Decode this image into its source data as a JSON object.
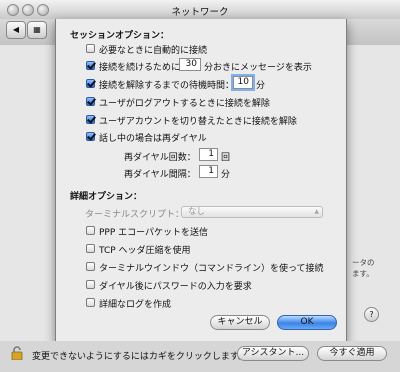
{
  "window": {
    "title": "ネットワーク"
  },
  "sheet": {
    "session_heading": "セッションオプション：",
    "session_options": [
      {
        "label": "必要なときに自動的に接続",
        "checked": false
      },
      {
        "label_before": "接続を続けるために",
        "value": "30",
        "label_after": "分おきにメッセージを表示",
        "checked": true
      },
      {
        "label_before": "接続を解除するまでの待機時間：",
        "value": "10",
        "label_after": "分",
        "checked": true
      },
      {
        "label": "ユーザがログアウトするときに接続を解除",
        "checked": true
      },
      {
        "label": "ユーザアカウントを切り替えたときに接続を解除",
        "checked": true
      },
      {
        "label": "話し中の場合は再ダイヤル",
        "checked": true
      }
    ],
    "redial_count": {
      "label": "再ダイヤル回数：",
      "value": "1",
      "unit": "回"
    },
    "redial_interval": {
      "label": "再ダイヤル間隔：",
      "value": "1",
      "unit": "分"
    },
    "advanced_heading": "詳細オプション：",
    "terminal_script": {
      "label": "ターミナルスクリプト：",
      "value": "なし"
    },
    "advanced_options": [
      {
        "label": "PPP エコーパケットを送信",
        "checked": false
      },
      {
        "label": "TCP ヘッダ圧縮を使用",
        "checked": false
      },
      {
        "label": "ターミナルウインドウ（コマンドライン）を使って接続",
        "checked": false
      },
      {
        "label": "ダイヤル後にパスワードの入力を要求",
        "checked": false
      },
      {
        "label": "詳細なログを作成",
        "checked": false
      }
    ],
    "cancel_label": "キャンセル",
    "ok_label": "OK"
  },
  "background": {
    "partial_text_1": "ータの",
    "partial_text_2": "ます。"
  },
  "bottom": {
    "lock_text": "変更できないようにするにはカギをクリックします。",
    "assistant_label": "アシスタント...",
    "apply_label": "今すぐ適用"
  },
  "colors": {
    "accent": "#3c84e8",
    "sheet_bg": "#ececec"
  },
  "icons": [
    "lock-icon",
    "help-icon"
  ]
}
